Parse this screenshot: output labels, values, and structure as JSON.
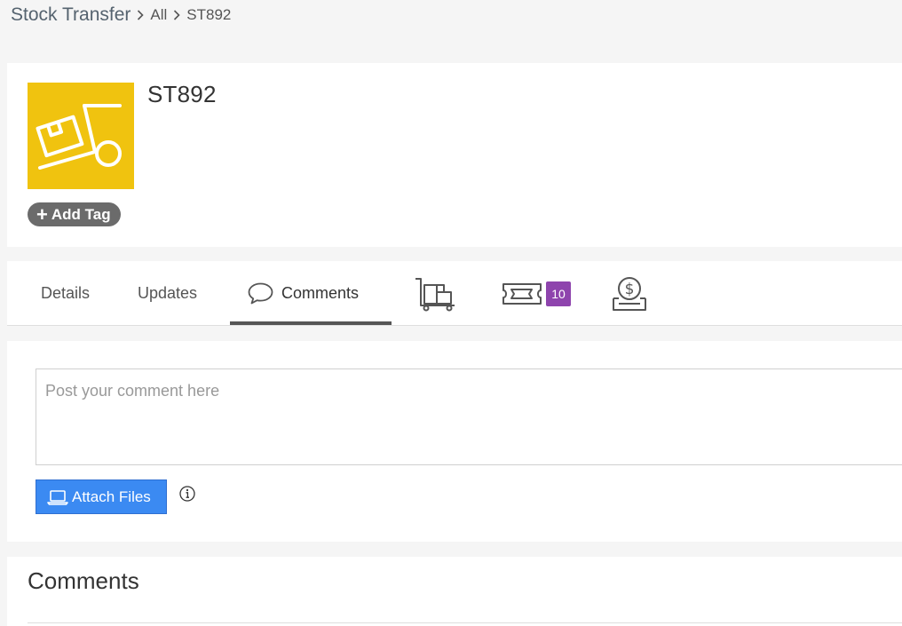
{
  "breadcrumb": {
    "root": "Stock Transfer",
    "items": [
      "All",
      "ST892"
    ]
  },
  "record": {
    "title": "ST892",
    "icon": "hand-truck-box-icon",
    "icon_bg": "#f0c30f",
    "add_tag_label": "Add Tag"
  },
  "tabs": {
    "details": "Details",
    "updates": "Updates",
    "comments": "Comments",
    "shipments_icon": "cart-icon",
    "tickets_icon": "ticket-icon",
    "tickets_badge": "10",
    "payments_icon": "money-tray-icon"
  },
  "comment_form": {
    "placeholder": "Post your comment here",
    "value": "",
    "attach_label": "Attach Files"
  },
  "comments_section": {
    "heading": "Comments"
  },
  "colors": {
    "accent_blue": "#3b8af2",
    "badge_purple": "#8e44ad",
    "tag_gray": "#6b6b6b"
  }
}
